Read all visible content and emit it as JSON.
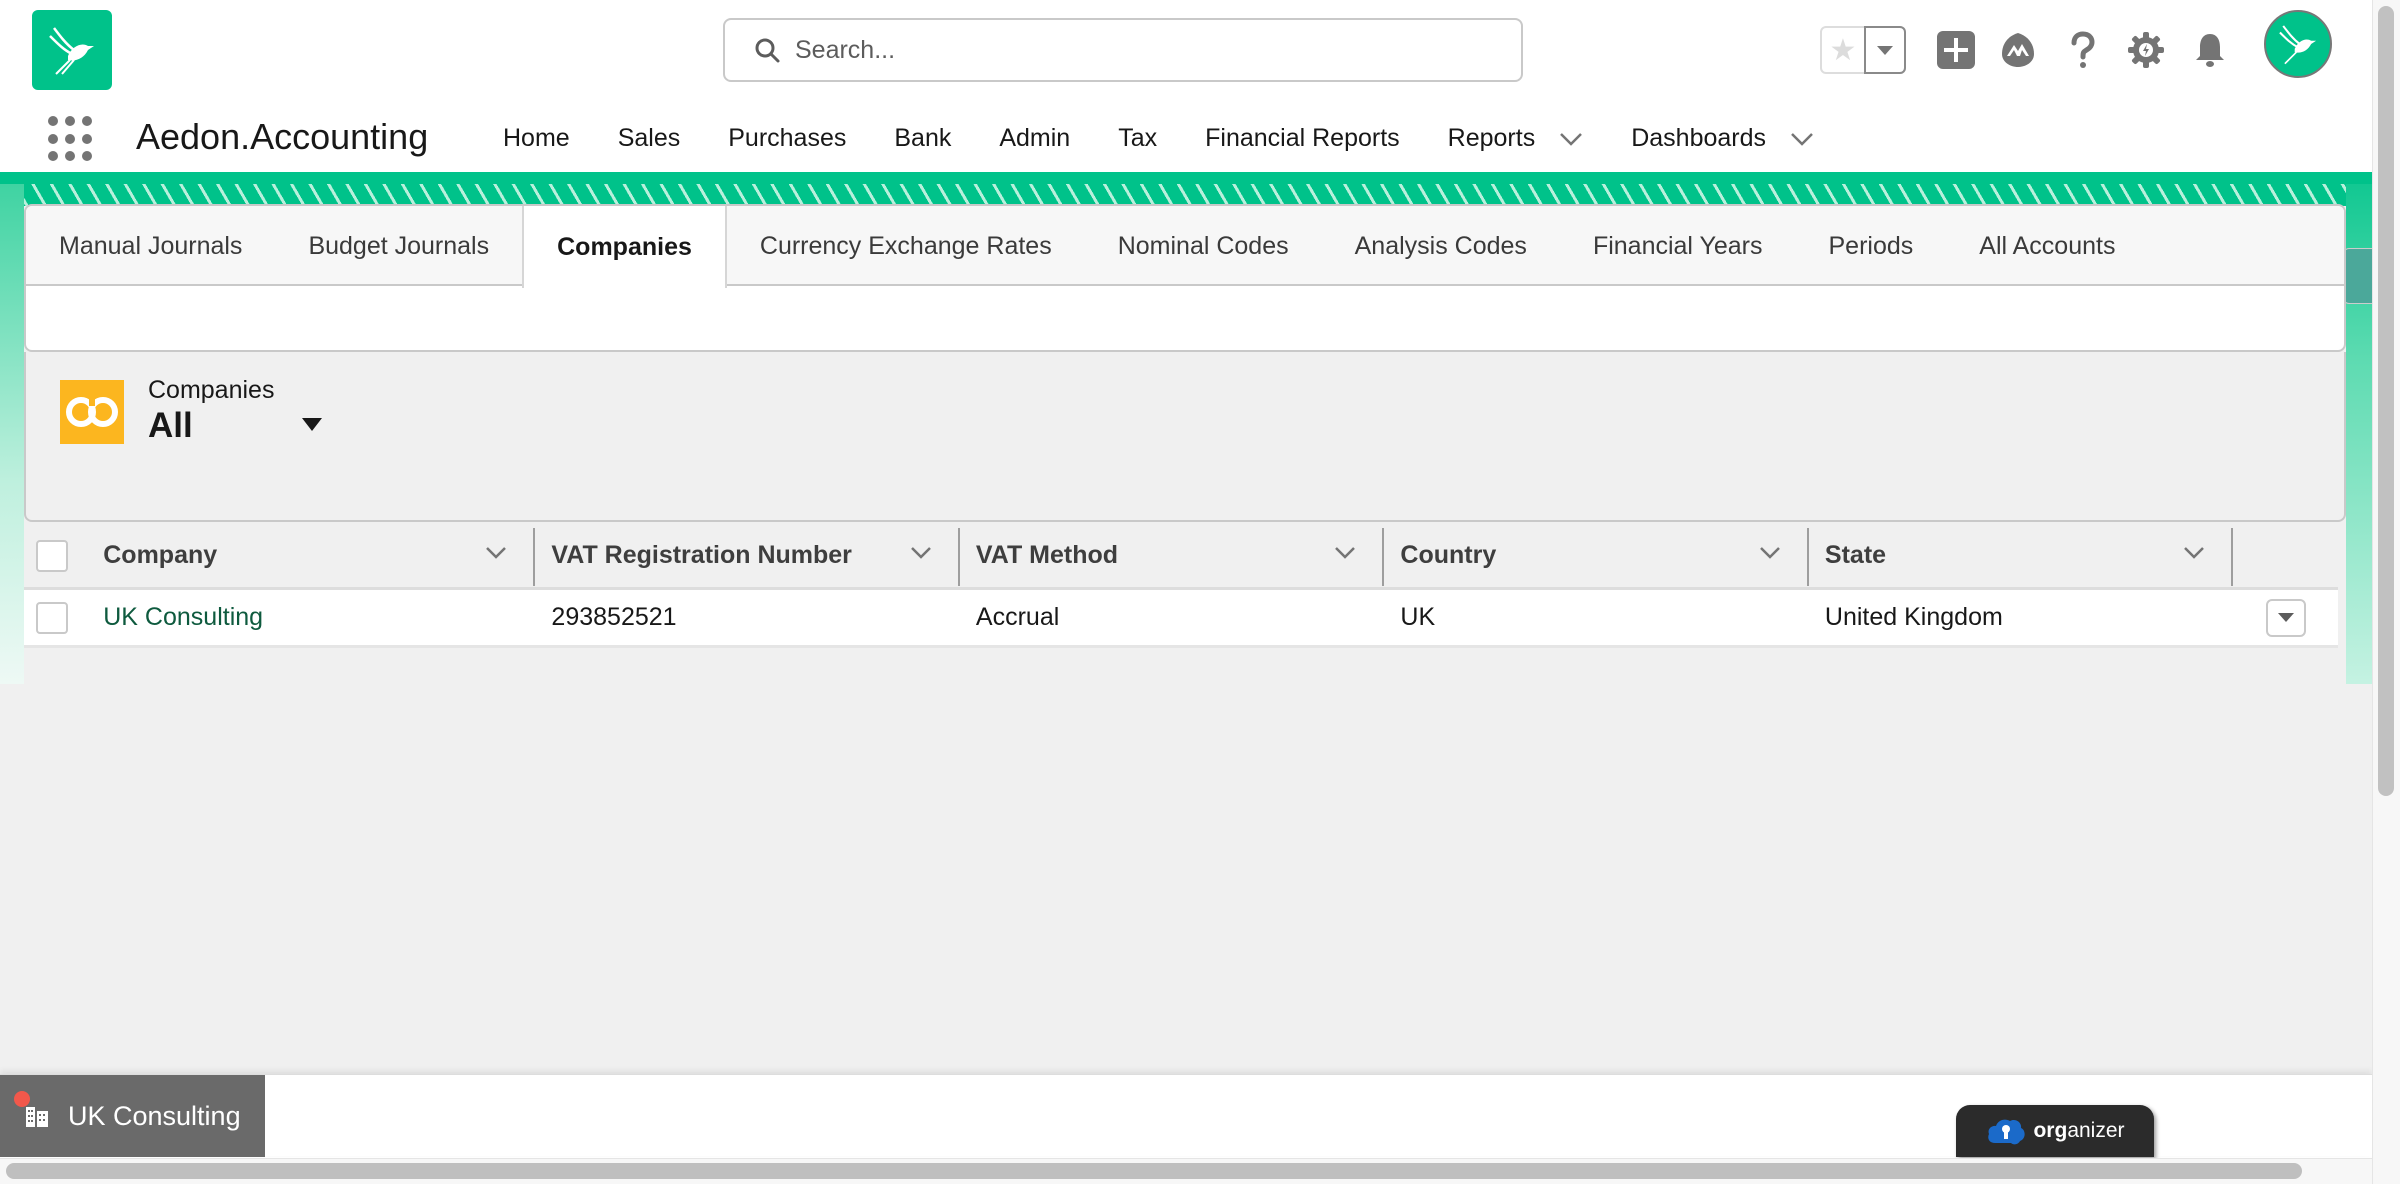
{
  "app": {
    "name": "Aedon.Accounting",
    "brand_color": "#00c28a"
  },
  "header": {
    "search_placeholder": "Search...",
    "icons": [
      "favorites-star-icon",
      "favorites-dropdown-icon",
      "global-actions-plus-icon",
      "trailhead-icon",
      "help-icon",
      "setup-gear-icon",
      "notifications-bell-icon",
      "user-avatar"
    ]
  },
  "nav": {
    "items": [
      {
        "label": "Home",
        "has_menu": false
      },
      {
        "label": "Sales",
        "has_menu": false
      },
      {
        "label": "Purchases",
        "has_menu": false
      },
      {
        "label": "Bank",
        "has_menu": false
      },
      {
        "label": "Admin",
        "has_menu": false
      },
      {
        "label": "Tax",
        "has_menu": false
      },
      {
        "label": "Financial Reports",
        "has_menu": false
      },
      {
        "label": "Reports",
        "has_menu": true
      },
      {
        "label": "Dashboards",
        "has_menu": true
      }
    ]
  },
  "tabs": {
    "items": [
      {
        "label": "Manual Journals",
        "active": false
      },
      {
        "label": "Budget Journals",
        "active": false
      },
      {
        "label": "Companies",
        "active": true
      },
      {
        "label": "Currency Exchange Rates",
        "active": false
      },
      {
        "label": "Nominal Codes",
        "active": false
      },
      {
        "label": "Analysis Codes",
        "active": false
      },
      {
        "label": "Financial Years",
        "active": false
      },
      {
        "label": "Periods",
        "active": false
      },
      {
        "label": "All Accounts",
        "active": false
      }
    ]
  },
  "list_view": {
    "object_label": "Companies",
    "view_name": "All",
    "icon_color": "#fcb61f"
  },
  "table": {
    "columns": [
      "Company",
      "VAT Registration Number",
      "VAT Method",
      "Country",
      "State"
    ],
    "rows": [
      {
        "company": "UK Consulting",
        "vat_registration_number": "293852521",
        "vat_method": "Accrual",
        "country": "UK",
        "state": "United Kingdom"
      }
    ]
  },
  "utility_bar": {
    "item_label": "UK Consulting",
    "organizer_prefix": "org",
    "organizer_suffix": "anizer"
  }
}
